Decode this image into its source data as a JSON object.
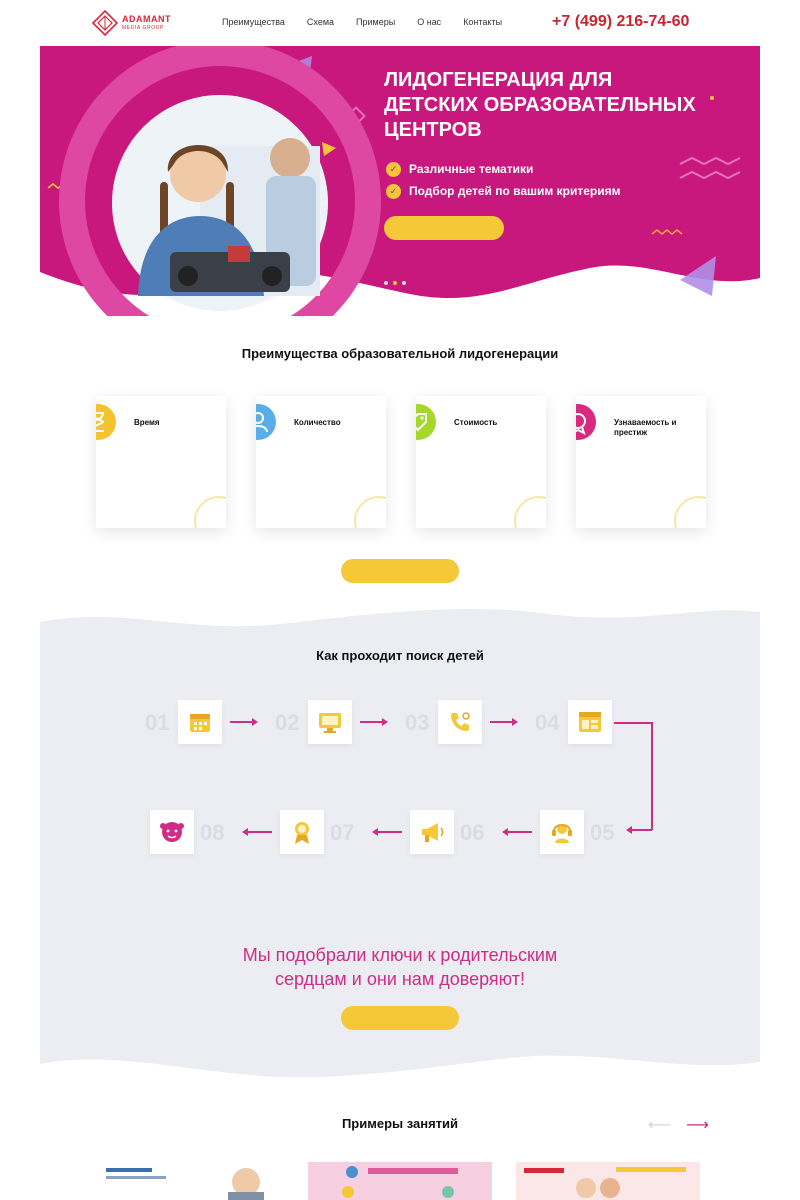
{
  "header": {
    "logo_name": "ADAMANT",
    "logo_sub": "MEDIA GROUP",
    "nav": [
      "Преимущества",
      "Схема",
      "Примеры",
      "О нас",
      "Контакты"
    ],
    "phone": "+7 (499) 216-74-60"
  },
  "hero": {
    "title_lines": [
      "ЛИДОГЕНЕРАЦИЯ ДЛЯ",
      "ДЕТСКИХ ОБРАЗОВАТЕЛЬНЫХ",
      "ЦЕНТРОВ"
    ],
    "bullets": [
      "Различные тематики",
      "Подбор детей по вашим критериям"
    ],
    "button": "",
    "slides": 3,
    "active_slide": 2
  },
  "advantages": {
    "title": "Преимущества образовательной лидогенерации",
    "cards": [
      {
        "title": "Время",
        "text": "",
        "color": "#f5c32e",
        "icon": "hourglass-icon"
      },
      {
        "title": "Количество",
        "text": "",
        "color": "#5aaee8",
        "icon": "people-icon"
      },
      {
        "title": "Стоимость",
        "text": "",
        "color": "#a6d82c",
        "icon": "price-tag-icon"
      },
      {
        "title": "Узнаваемость и престиж",
        "text": "",
        "color": "#d9287f",
        "icon": "award-icon"
      }
    ],
    "button": ""
  },
  "steps": {
    "title": "Как проходит поиск детей",
    "items": [
      {
        "num": "01",
        "text": "",
        "icon": "calendar-icon"
      },
      {
        "num": "02",
        "text": "",
        "icon": "monitor-icon"
      },
      {
        "num": "03",
        "text": "",
        "icon": "phone-icon"
      },
      {
        "num": "04",
        "text": "",
        "icon": "browser-icon"
      },
      {
        "num": "05",
        "text": "",
        "icon": "headset-icon"
      },
      {
        "num": "06",
        "text": "",
        "icon": "megaphone-icon"
      },
      {
        "num": "07",
        "text": "",
        "icon": "medal-icon"
      },
      {
        "num": "08",
        "text": "",
        "icon": "children-icon"
      }
    ],
    "slogan_lines": [
      "Мы подобрали ключи к родительским",
      "сердцам и они нам доверяют!"
    ],
    "button": ""
  },
  "examples": {
    "title": "Примеры занятий"
  },
  "colors": {
    "magenta": "#c8187e",
    "magenta_light": "#e04aa0",
    "yellow": "#f5c83a",
    "grey_bg": "#ecedf2",
    "red": "#c8252f"
  }
}
